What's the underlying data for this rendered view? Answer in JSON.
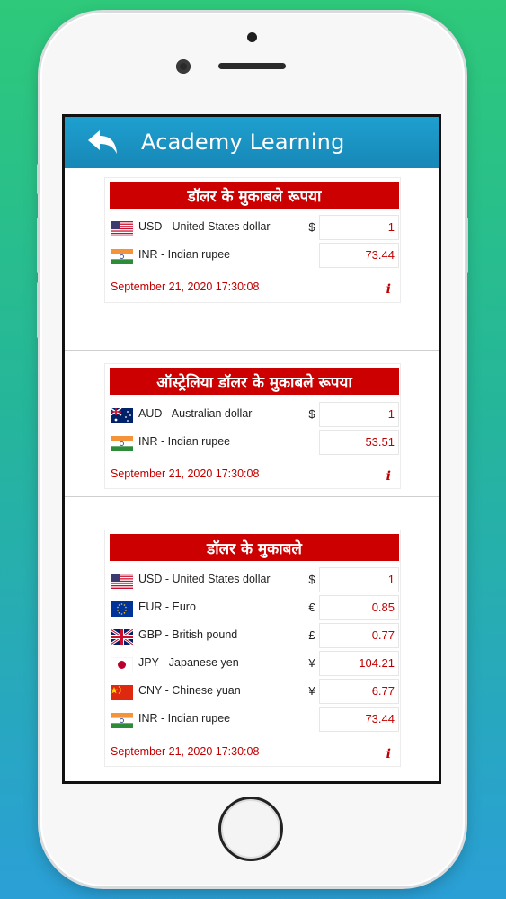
{
  "app": {
    "title": "Academy Learning"
  },
  "sections": [
    {
      "title": "डॉलर के मुकाबले रूपया",
      "rows": [
        {
          "flag": "us-flag-icon",
          "code_name": "USD - United States dollar",
          "symbol": "$",
          "value": "1"
        },
        {
          "flag": "in-flag-icon",
          "code_name": "INR - Indian rupee",
          "symbol": "",
          "value": "73.44"
        }
      ],
      "timestamp": "September 21, 2020 17:30:08",
      "info": "i"
    },
    {
      "title": "ऑस्ट्रेलिया डॉलर के मुकाबले रूपया",
      "rows": [
        {
          "flag": "au-flag-icon",
          "code_name": "AUD - Australian dollar",
          "symbol": "$",
          "value": "1"
        },
        {
          "flag": "in-flag-icon",
          "code_name": "INR - Indian rupee",
          "symbol": "",
          "value": "53.51"
        }
      ],
      "timestamp": "September 21, 2020 17:30:08",
      "info": "i"
    },
    {
      "title": "डॉलर के मुकाबले",
      "rows": [
        {
          "flag": "us-flag-icon",
          "code_name": "USD - United States dollar",
          "symbol": "$",
          "value": "1"
        },
        {
          "flag": "eu-flag-icon",
          "code_name": "EUR - Euro",
          "symbol": "€",
          "value": "0.85"
        },
        {
          "flag": "gb-flag-icon",
          "code_name": "GBP - British pound",
          "symbol": "£",
          "value": "0.77"
        },
        {
          "flag": "jp-flag-icon",
          "code_name": "JPY - Japanese yen",
          "symbol": "¥",
          "value": "104.21"
        },
        {
          "flag": "cn-flag-icon",
          "code_name": "CNY - Chinese yuan",
          "symbol": "¥",
          "value": "6.77"
        },
        {
          "flag": "in-flag-icon",
          "code_name": "INR - Indian rupee",
          "symbol": "",
          "value": "73.44"
        }
      ],
      "timestamp": "September 21, 2020 17:30:08",
      "info": "i"
    }
  ],
  "colors": {
    "accent_red": "#cc0000",
    "appbar_blue": "#1787b7",
    "value_red": "#c00000"
  }
}
